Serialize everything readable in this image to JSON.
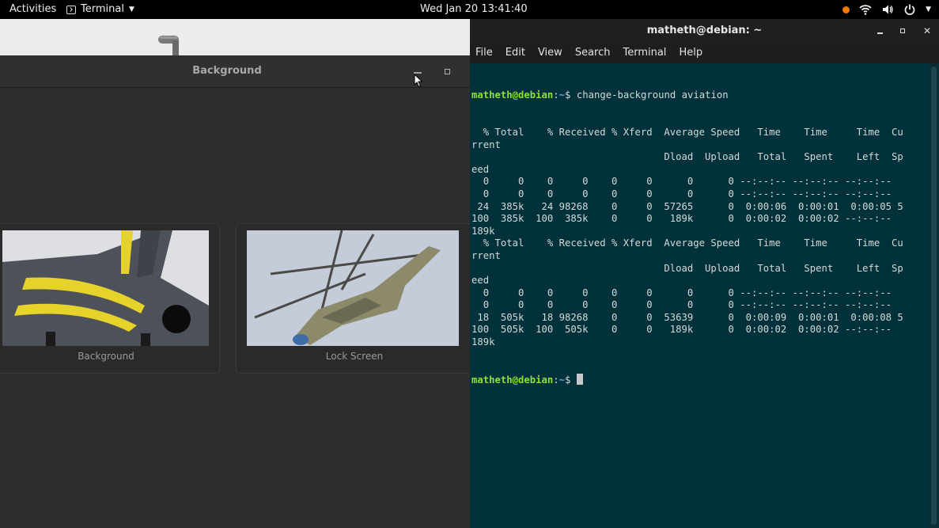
{
  "topbar": {
    "activities": "Activities",
    "app_menu": "Terminal",
    "clock": "Wed Jan 20  13:41:40",
    "status_icons": [
      "notification-dot",
      "wifi-icon",
      "volume-icon",
      "power-icon"
    ],
    "colors": {
      "notification": "#f57900"
    }
  },
  "background_window": {
    "title": "Background",
    "cards": [
      {
        "label": "Background",
        "image": "fighter-jet-photo"
      },
      {
        "label": "Lock Screen",
        "image": "helicopter-photo"
      }
    ]
  },
  "terminal": {
    "title": "matheth@debian: ~",
    "menus": [
      "File",
      "Edit",
      "View",
      "Search",
      "Terminal",
      "Help"
    ],
    "prompt_user": "matheth@debian",
    "prompt_path": "~",
    "command": "change-background aviation",
    "output_lines": [
      "  % Total    % Received % Xferd  Average Speed   Time    Time     Time  Cu",
      "rrent",
      "                                 Dload  Upload   Total   Spent    Left  Sp",
      "eed",
      "  0     0    0     0    0     0      0      0 --:--:-- --:--:-- --:--:--",
      "  0     0    0     0    0     0      0      0 --:--:-- --:--:-- --:--:--",
      " 24  385k   24 98268    0     0  57265      0  0:00:06  0:00:01  0:00:05 5",
      "100  385k  100  385k    0     0   189k      0  0:00:02  0:00:02 --:--:--",
      "189k",
      "  % Total    % Received % Xferd  Average Speed   Time    Time     Time  Cu",
      "rrent",
      "                                 Dload  Upload   Total   Spent    Left  Sp",
      "eed",
      "  0     0    0     0    0     0      0      0 --:--:-- --:--:-- --:--:--",
      "  0     0    0     0    0     0      0      0 --:--:-- --:--:-- --:--:--",
      " 18  505k   18 98268    0     0  53639      0  0:00:09  0:00:01  0:00:08 5",
      "100  505k  100  505k    0     0   189k      0  0:00:02  0:00:02 --:--:--",
      "189k"
    ],
    "colors": {
      "background": "#01313a",
      "prompt_user": "#8ae234",
      "prompt_path": "#729fcf"
    }
  }
}
